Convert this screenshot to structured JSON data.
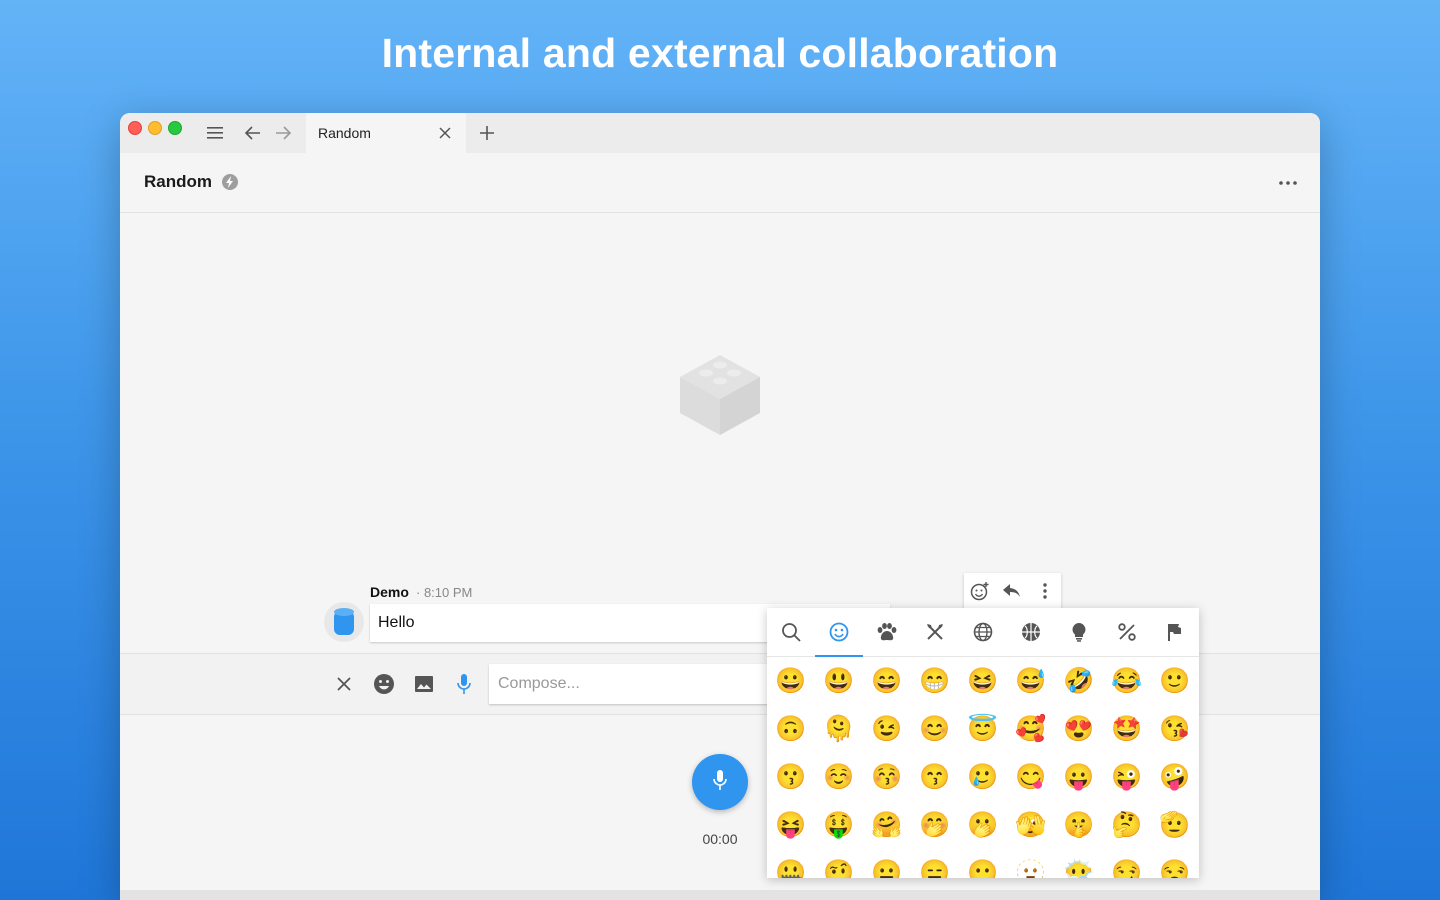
{
  "headline": "Internal and external collaboration",
  "tab": {
    "title": "Random"
  },
  "room": {
    "name": "Random"
  },
  "message": {
    "author": "Demo",
    "time": "· 8:10 PM",
    "text": "Hello"
  },
  "composer": {
    "placeholder": "Compose..."
  },
  "recorder": {
    "time": "00:00"
  },
  "emoji_picker": {
    "categories": [
      "search",
      "smileys",
      "animals",
      "food",
      "travel",
      "activities",
      "objects",
      "symbols",
      "flags"
    ],
    "active_category": "smileys",
    "emojis": [
      "😀",
      "😃",
      "😄",
      "😁",
      "😆",
      "😅",
      "🤣",
      "😂",
      "🙂",
      "🙃",
      "🫠",
      "😉",
      "😊",
      "😇",
      "🥰",
      "😍",
      "🤩",
      "😘",
      "😗",
      "☺️",
      "😚",
      "😙",
      "🥲",
      "😋",
      "😛",
      "😜",
      "🤪",
      "😝",
      "🤑",
      "🤗",
      "🤭",
      "🫢",
      "🫣",
      "🤫",
      "🤔",
      "🫡",
      "🤐",
      "🤨",
      "😐",
      "😑",
      "😶",
      "🫥",
      "😶‍🌫️",
      "😏",
      "😒"
    ]
  },
  "colors": {
    "accent": "#2f95ee",
    "background_top": "#63b3f7",
    "background_bottom": "#1f76d8"
  }
}
